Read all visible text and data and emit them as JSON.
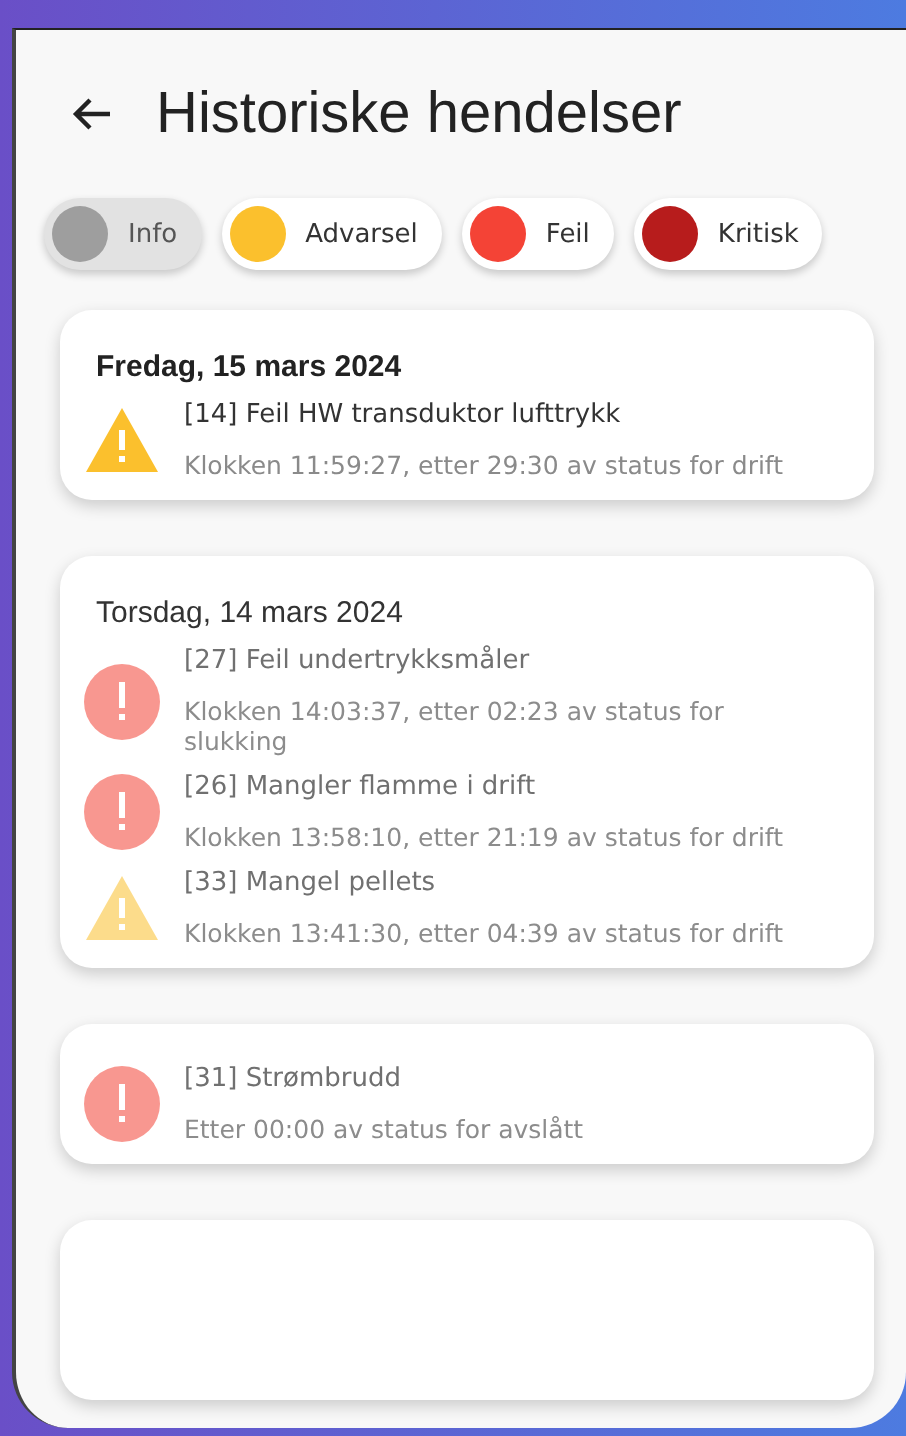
{
  "header": {
    "title": "Historiske hendelser"
  },
  "filters": [
    {
      "label": "Info",
      "color": "#9e9e9e",
      "selected": true
    },
    {
      "label": "Advarsel",
      "color": "#fbc02d",
      "selected": false
    },
    {
      "label": "Feil",
      "color": "#f44336",
      "selected": false
    },
    {
      "label": "Kritisk",
      "color": "#b71c1c",
      "selected": false
    }
  ],
  "groups": [
    {
      "date": "Fredag, 15 mars 2024",
      "dimmed": false,
      "events": [
        {
          "kind": "warning",
          "title": "[14] Feil HW transduktor lufttrykk",
          "detail": "Klokken 11:59:27, etter 29:30 av status for drift"
        }
      ]
    },
    {
      "date": "Torsdag, 14 mars 2024",
      "dimmed": true,
      "events": [
        {
          "kind": "error",
          "title": "[27] Feil undertrykksmåler",
          "detail": "Klokken 14:03:37, etter 02:23 av status for slukking"
        },
        {
          "kind": "error",
          "title": "[26] Mangler flamme i drift",
          "detail": "Klokken 13:58:10, etter 21:19 av status for drift"
        },
        {
          "kind": "warning",
          "title": "[33] Mangel pellets",
          "detail": "Klokken 13:41:30, etter 04:39 av status for drift"
        }
      ]
    },
    {
      "dimmed": true,
      "events": [
        {
          "kind": "error",
          "title": "[31] Strømbrudd",
          "detail": "Etter 00:00 av status for avslått"
        }
      ]
    }
  ]
}
